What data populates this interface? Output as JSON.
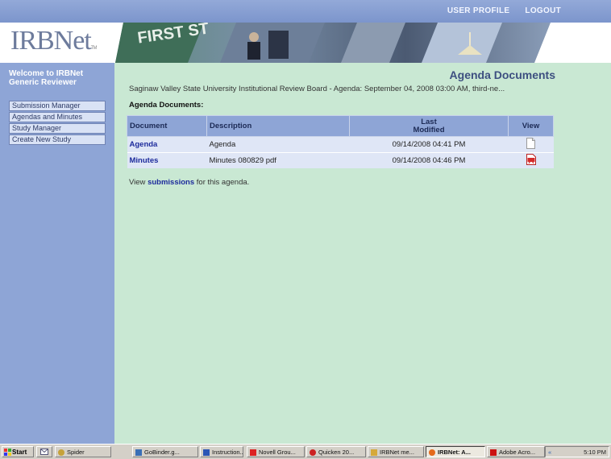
{
  "topnav": {
    "profile": "USER PROFILE",
    "logout": "LOGOUT"
  },
  "logo": {
    "text": "IRBNet",
    "tm": "TM"
  },
  "sidebar": {
    "welcome": "Welcome to IRBNet Generic Reviewer",
    "items": [
      {
        "label": "Submission Manager"
      },
      {
        "label": "Agendas and Minutes"
      },
      {
        "label": "Study Manager"
      },
      {
        "label": "Create New Study"
      }
    ]
  },
  "main": {
    "title": "Agenda Documents",
    "subtitle": "Saginaw Valley State University Institutional Review Board - Agenda: September 04, 2008 03:00 AM, third-ne...",
    "table_title": "Agenda Documents:",
    "columns": {
      "document": "Document",
      "description": "Description",
      "last": "Last",
      "modified": "Modified",
      "view": "View"
    },
    "rows": [
      {
        "document": "Agenda",
        "description": "Agenda",
        "modified": "09/14/2008 04:41 PM",
        "view_icon": "document-icon"
      },
      {
        "document": "Minutes",
        "description": "Minutes 080829 pdf",
        "modified": "09/14/2008 04:46 PM",
        "view_icon": "pdf-icon"
      }
    ],
    "view_prefix": "View",
    "view_link": "submissions",
    "view_suffix": "for this agenda."
  },
  "taskbar": {
    "start": "Start",
    "buttons": [
      {
        "label": "Spider"
      },
      {
        "label": "GoBinder.g..."
      },
      {
        "label": "Instruction..."
      },
      {
        "label": "Novell Grou..."
      },
      {
        "label": "Quicken 20..."
      },
      {
        "label": "IRBNet me..."
      },
      {
        "label": "IRBNet: A..."
      },
      {
        "label": "Adobe Acro..."
      }
    ],
    "clock": "5:10 PM"
  },
  "colors": {
    "accent": "#8ea5d6",
    "background": "#c9e8d3",
    "link": "#1d2b9c"
  }
}
